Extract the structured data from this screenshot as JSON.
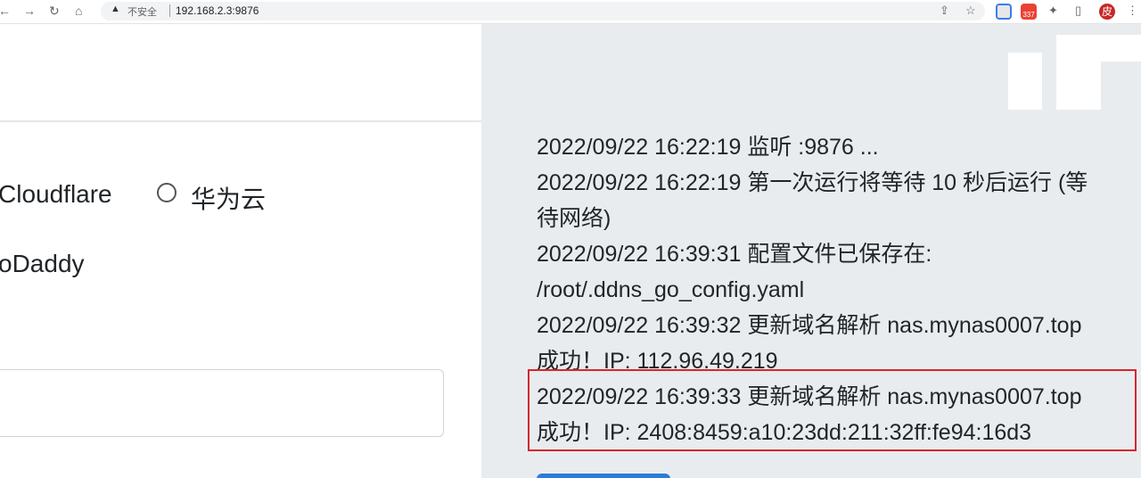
{
  "browser": {
    "security_label": "不安全",
    "url": "192.168.2.3:9876",
    "badge_count": "337",
    "avatar_letter": "皮"
  },
  "form": {
    "provider_cloudflare": "Cloudflare",
    "provider_huawei": "华为云",
    "provider_godaddy": "oDaddy"
  },
  "logs": [
    "2022/09/22 16:22:19 监听 :9876 ...",
    "2022/09/22 16:22:19 第一次运行将等待 10 秒后运行 (等",
    "待网络)",
    "2022/09/22 16:39:31 配置文件已保存在:",
    "/root/.ddns_go_config.yaml",
    "2022/09/22 16:39:32 更新域名解析 nas.mynas0007.top",
    "成功！IP: 112.96.49.219",
    "2022/09/22 16:39:33 更新域名解析 nas.mynas0007.top",
    "成功！IP: 2408:8459:a10:23dd:211:32ff:fe94:16d3"
  ],
  "colors": {
    "highlight_border": "#d7262c",
    "log_panel_bg": "#e9ecef",
    "primary_button": "#2b7bd6"
  }
}
